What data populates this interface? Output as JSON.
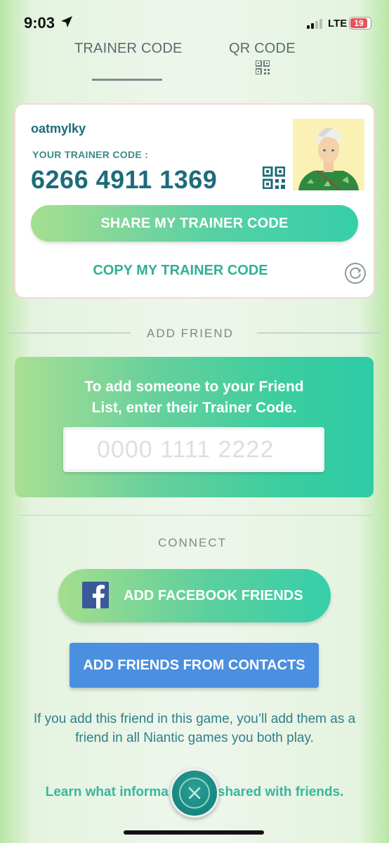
{
  "status_bar": {
    "time": "9:03",
    "network": "LTE",
    "battery": "19"
  },
  "tabs": [
    {
      "label": "TRAINER CODE",
      "active": true
    },
    {
      "label": "QR CODE",
      "active": false
    }
  ],
  "trainer_card": {
    "username": "oatmylky",
    "code_label": "YOUR TRAINER CODE :",
    "code": "6266 4911 1369",
    "share_label": "SHARE MY TRAINER CODE",
    "copy_label": "COPY MY TRAINER CODE"
  },
  "add_friend": {
    "section_title": "ADD FRIEND",
    "instructions_line1": "To add someone to your Friend",
    "instructions_line2": "List, enter their Trainer Code.",
    "input_placeholder": "0000 1111 2222"
  },
  "connect": {
    "section_title": "CONNECT",
    "facebook_label": "ADD FACEBOOK FRIENDS",
    "contacts_label": "ADD FRIENDS FROM CONTACTS"
  },
  "footer": {
    "disclaimer": "If you add this friend in this game, you’ll add them as a friend in all Niantic games you both play.",
    "learn_left": "Learn what informa",
    "learn_right": "shared with friends."
  },
  "colors": {
    "accent_teal": "#1c6c7b",
    "button_gradient_start": "#a7de8f",
    "button_gradient_end": "#35cfa9",
    "contacts_blue": "#4b8fe0",
    "battery_low": "#e3555a"
  },
  "icons": [
    "location-arrow-icon",
    "signal-icon",
    "battery-icon",
    "qr-code-icon",
    "refresh-icon",
    "facebook-icon",
    "close-icon"
  ]
}
